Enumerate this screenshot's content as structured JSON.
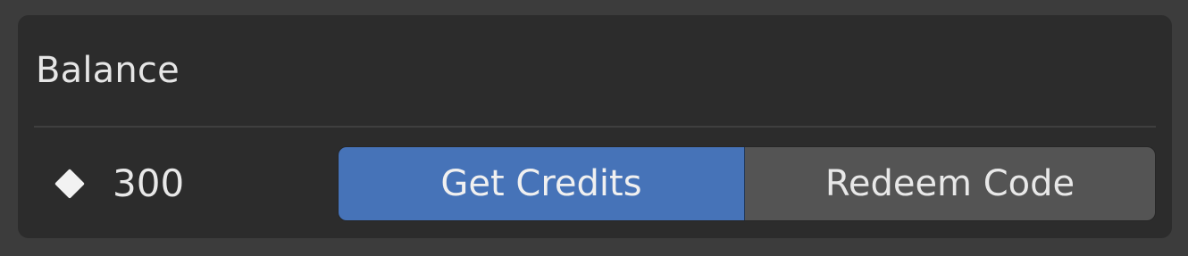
{
  "panel": {
    "title": "Balance"
  },
  "balance": {
    "icon": "diamond-icon",
    "amount": "300"
  },
  "actions": {
    "get_credits_label": "Get Credits",
    "redeem_code_label": "Redeem Code"
  },
  "colors": {
    "background": "#3c3c3c",
    "panel": "#2c2c2c",
    "primary": "#4673b8",
    "secondary": "#545454",
    "text": "#e6e6e6"
  }
}
